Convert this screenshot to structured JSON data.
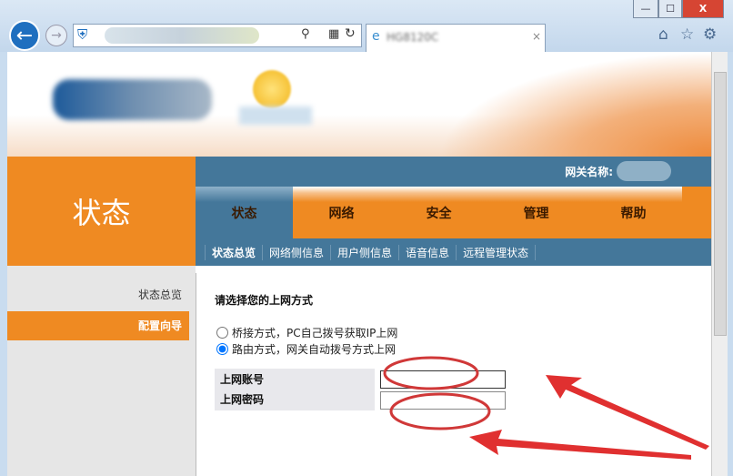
{
  "browser": {
    "tab_title": "HG8120C",
    "close_tab": "×",
    "window_buttons": [
      "—",
      "☐",
      "X"
    ]
  },
  "header": {
    "section_title": "状态",
    "gateway_label": "网关名称:"
  },
  "tabs": [
    {
      "label": "状态",
      "active": true
    },
    {
      "label": "网络"
    },
    {
      "label": "安全"
    },
    {
      "label": "管理"
    },
    {
      "label": "帮助"
    }
  ],
  "subnav": [
    {
      "label": "状态总览",
      "active": true
    },
    {
      "label": "网络侧信息"
    },
    {
      "label": "用户侧信息"
    },
    {
      "label": "语音信息"
    },
    {
      "label": "远程管理状态"
    }
  ],
  "sidebar": [
    {
      "label": "状态总览"
    },
    {
      "label": "配置向导",
      "active": true
    }
  ],
  "main": {
    "heading": "请选择您的上网方式",
    "options": [
      {
        "label": "桥接方式，PC自己拨号获取IP上网",
        "checked": false
      },
      {
        "label": "路由方式，网关自动拨号方式上网",
        "checked": true
      }
    ],
    "account_label": "上网账号",
    "password_label": "上网密码",
    "account_value": "",
    "password_value": ""
  },
  "colors": {
    "orange": "#ef8a22",
    "blue": "#44779a",
    "annotation": "#e03030"
  }
}
